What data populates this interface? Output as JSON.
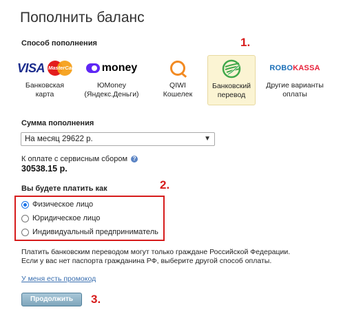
{
  "page": {
    "title": "Пополнить баланс"
  },
  "markers": {
    "m1": "1.",
    "m2": "2.",
    "m3": "3."
  },
  "payment": {
    "label": "Способ пополнения",
    "methods": [
      {
        "id": "card",
        "label": "Банковская карта",
        "logo": "visa-mastercard-logo",
        "logo_text_1": "VISA",
        "logo_text_2": "MasterCard",
        "selected": false
      },
      {
        "id": "yoomoney",
        "label": "ЮMoney (Яндекс.Деньги)",
        "logo": "yoomoney-logo",
        "logo_text": "money",
        "selected": false
      },
      {
        "id": "qiwi",
        "label": "QIWI Кошелек",
        "logo": "qiwi-logo",
        "selected": false
      },
      {
        "id": "bank",
        "label": "Банковский перевод",
        "logo": "sberbank-logo",
        "selected": true
      },
      {
        "id": "other",
        "label": "Другие варианты оплаты",
        "logo": "robokassa-logo",
        "logo_text_1": "ROBO",
        "logo_text_2": "KASSA",
        "selected": false
      }
    ]
  },
  "amount": {
    "label": "Сумма пополнения",
    "selected": "На месяц 29622 р.",
    "fee_label": "К оплате с сервисным сбором",
    "fee_amount": "30538.15 р."
  },
  "payer": {
    "label": "Вы будете платить как",
    "options": [
      {
        "label": "Физическое лицо",
        "checked": true
      },
      {
        "label": "Юридическое лицо",
        "checked": false
      },
      {
        "label": "Индивидуальный предприниматель",
        "checked": false
      }
    ]
  },
  "note": {
    "line1": "Платить банковским переводом могут только граждане Российской Федерации.",
    "line2": "Если у вас нет паспорта гражданина РФ, выберите другой способ оплаты."
  },
  "promo_link": "У меня есть промокод",
  "continue_button": "Продолжить",
  "colors": {
    "accent_red": "#d61b1b",
    "link": "#3a6fb0",
    "selected_bg": "#fbf4d3"
  }
}
